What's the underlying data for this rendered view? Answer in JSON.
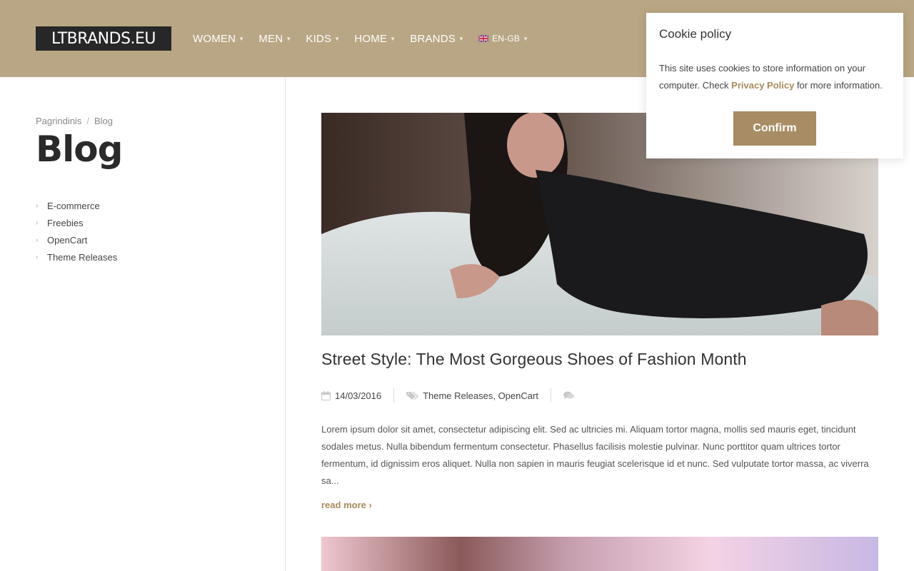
{
  "header": {
    "logo_text": "LTBRANDS.EU",
    "nav": [
      {
        "label": "WOMEN"
      },
      {
        "label": "MEN"
      },
      {
        "label": "KIDS"
      },
      {
        "label": "HOME"
      },
      {
        "label": "BRANDS"
      }
    ],
    "language": {
      "label": "EN-GB",
      "icon": "uk-flag-icon"
    }
  },
  "sidebar": {
    "breadcrumb": [
      "Pagrindinis",
      "Blog"
    ],
    "breadcrumb_separator": "/",
    "title": "Blog",
    "categories": [
      {
        "label": "E-commerce"
      },
      {
        "label": "Freebies"
      },
      {
        "label": "OpenCart"
      },
      {
        "label": "Theme Releases"
      }
    ]
  },
  "post": {
    "title": "Street Style: The Most Gorgeous Shoes of Fashion Month",
    "date": "14/03/2016",
    "date_icon": "calendar-icon",
    "tags": "Theme Releases, OpenCart",
    "tags_icon": "tags-icon",
    "comments_icon": "comments-icon",
    "excerpt": "Lorem ipsum dolor sit amet, consectetur adipiscing elit. Sed ac ultricies mi. Aliquam tortor magna, mollis sed mauris eget, tincidunt sodales metus. Nulla bibendum fermentum consectetur. Phasellus facilisis molestie pulvinar. Nunc porttitor quam ultrices tortor fermentum, id dignissim eros aliquet. Nulla non sapien in mauris feugiat scelerisque id et nunc. Sed vulputate tortor massa, ac viverra sa...",
    "read_more": "read more ›"
  },
  "cookie": {
    "title": "Cookie policy",
    "text_before": "This site uses cookies to store information on your computer. Check ",
    "link": "Privacy Policy",
    "text_after": " for more information.",
    "confirm": "Confirm"
  },
  "colors": {
    "header_bg": "#b9a684",
    "accent": "#a88c63",
    "logo_bg": "#272727"
  }
}
